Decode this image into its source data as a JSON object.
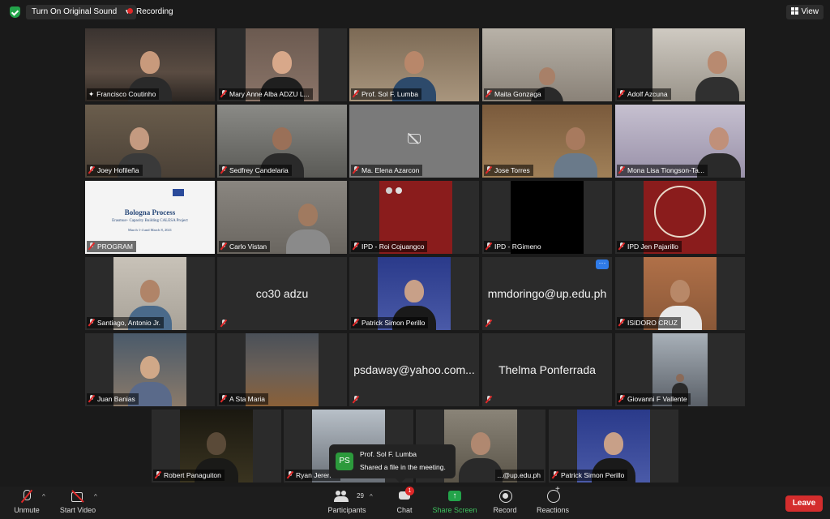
{
  "topbar": {
    "original_sound_label": "Turn On Original Sound",
    "recording_label": "Recording",
    "view_label": "View"
  },
  "participants": [
    {
      "name": "Francisco Coutinho",
      "type": "video"
    },
    {
      "name": "Mary Anne Alba ADZU L...",
      "type": "video"
    },
    {
      "name": "Prof. Sol F. Lumba",
      "type": "video"
    },
    {
      "name": "Maita Gonzaga",
      "type": "video"
    },
    {
      "name": "Adolf Azcuna",
      "type": "video"
    },
    {
      "name": "Joey Hofileña",
      "type": "video"
    },
    {
      "name": "Sedfrey Candelaria",
      "type": "video"
    },
    {
      "name": "Ma. Elena Azarcon",
      "type": "camera-off"
    },
    {
      "name": "Jose Torres",
      "type": "video"
    },
    {
      "name": "Mona Lisa Tiongson-Ta...",
      "type": "video"
    },
    {
      "name": "PROGRAM",
      "type": "slide"
    },
    {
      "name": "Carlo Vistan",
      "type": "video"
    },
    {
      "name": "IPD - Roi Cojuangco",
      "type": "video"
    },
    {
      "name": "IPD - RGimeno",
      "type": "video"
    },
    {
      "name": "IPD Jen Pajarillo",
      "type": "video"
    },
    {
      "name": "Santiago, Antonio Jr.",
      "type": "video"
    },
    {
      "name": "co30 adzu",
      "type": "text"
    },
    {
      "name": "Patrick Simon Perillo",
      "type": "video"
    },
    {
      "name": "mmdoringo@up.edu.ph",
      "type": "text"
    },
    {
      "name": "ISIDORO CRUZ",
      "type": "video"
    },
    {
      "name": "Juan Banias",
      "type": "video"
    },
    {
      "name": "A Sta Maria",
      "type": "video"
    },
    {
      "name": "psdaway@yahoo.com...",
      "type": "text"
    },
    {
      "name": "Thelma Ponferrada",
      "type": "text"
    },
    {
      "name": "Giovanni F Vallente",
      "type": "video"
    },
    {
      "name": "Robert Panaguiton",
      "type": "video"
    },
    {
      "name": "Ryan Jeren...",
      "type": "video"
    },
    {
      "name": "...@up.edu.ph",
      "type": "video"
    },
    {
      "name": "Patrick Simon Perillo",
      "type": "video"
    }
  ],
  "slide": {
    "title": "Bologna Process",
    "subtitle": "Erasmus+ Capacity Building CALESA Project",
    "dates": "March 1-4 and March 8, 2021"
  },
  "toast": {
    "avatar_initials": "PS",
    "sender": "Prof. Sol F. Lumba",
    "message": "Shared a file in the meeting."
  },
  "toolbar": {
    "unmute_label": "Unmute",
    "start_video_label": "Start Video",
    "participants_label": "Participants",
    "participants_count": "29",
    "chat_label": "Chat",
    "chat_badge": "1",
    "share_label": "Share Screen",
    "record_label": "Record",
    "reactions_label": "Reactions",
    "leave_label": "Leave"
  },
  "colors": {
    "active_speaker_border": "#c6d95a",
    "share_green": "#23a34a",
    "leave_red": "#d42d2d",
    "recording_red": "#e02828"
  }
}
